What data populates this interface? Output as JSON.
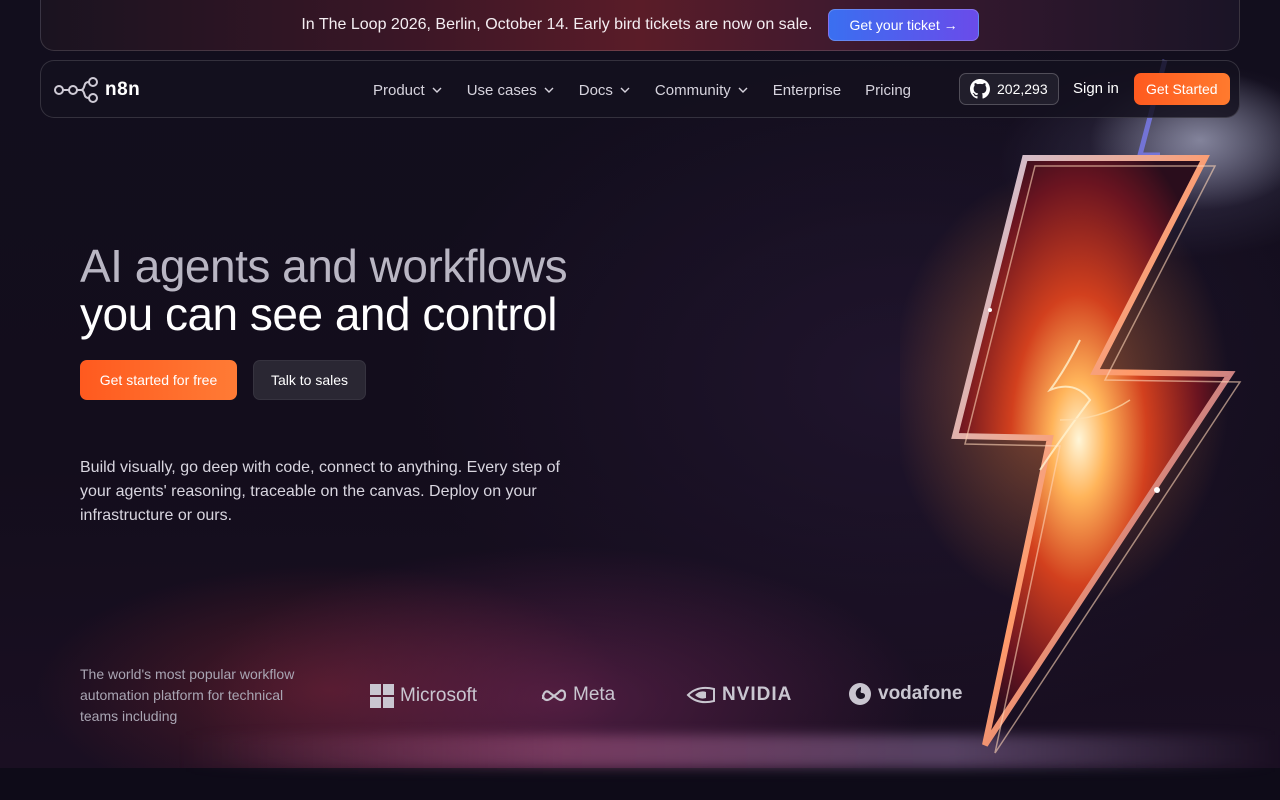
{
  "banner": {
    "text": "In The Loop 2026, Berlin, October 14. Early bird tickets are now on sale.",
    "button_label": "Get your ticket →"
  },
  "nav": {
    "logo_text": "n8n",
    "items": [
      {
        "label": "Product",
        "has_dropdown": true
      },
      {
        "label": "Use cases",
        "has_dropdown": true
      },
      {
        "label": "Docs",
        "has_dropdown": true
      },
      {
        "label": "Community",
        "has_dropdown": true
      },
      {
        "label": "Enterprise",
        "has_dropdown": false
      },
      {
        "label": "Pricing",
        "has_dropdown": false
      }
    ],
    "github_stars": "202,293",
    "signin_label": "Sign in",
    "get_started_label": "Get Started"
  },
  "hero": {
    "headline_line1": "AI agents and workflows",
    "headline_line2": "you can see and control",
    "cta_primary": "Get started for free",
    "cta_secondary": "Talk to sales",
    "description": "Build visually, go deep with code, connect to anything. Every step of your agents' reasoning, traceable on the canvas. Deploy on your infrastructure or ours."
  },
  "trust": {
    "text": "The world's most popular workflow automation platform for technical teams including",
    "brands": [
      "Microsoft",
      "Meta",
      "NVIDIA",
      "vodafone"
    ]
  },
  "colors": {
    "background": "#0e0b18",
    "accent_orange": "#ff5a1f",
    "banner_button": "#4f5cf0"
  },
  "icons": {
    "logo": "n8n-nodes-icon",
    "github": "github-icon",
    "chevron": "chevron-down-icon",
    "hero_art": "lightning-bolt-illustration"
  }
}
